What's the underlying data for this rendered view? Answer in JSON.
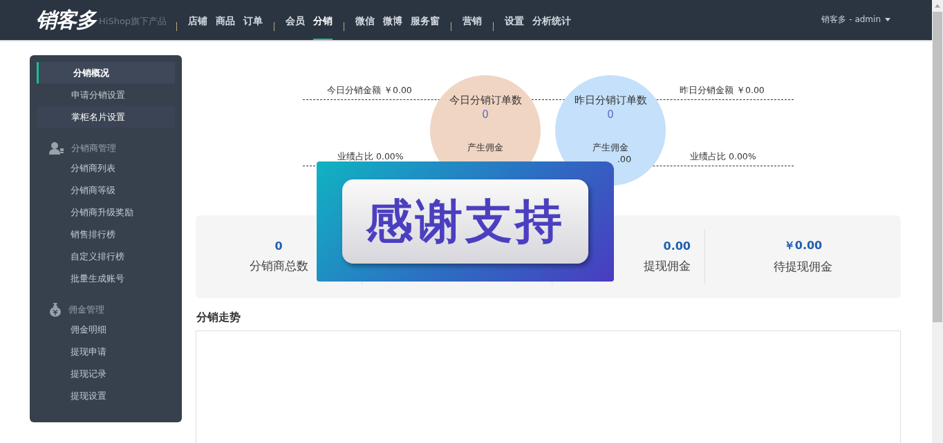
{
  "header": {
    "logo": "销客多",
    "tagline": "HiShop旗下产品",
    "nav": [
      {
        "kind": "sep"
      },
      {
        "kind": "link",
        "label": "店铺",
        "selected": false
      },
      {
        "kind": "link",
        "label": "商品",
        "selected": false
      },
      {
        "kind": "link",
        "label": "订单",
        "selected": false
      },
      {
        "kind": "sep"
      },
      {
        "kind": "link",
        "label": "会员",
        "selected": false
      },
      {
        "kind": "link",
        "label": "分销",
        "selected": true
      },
      {
        "kind": "sep"
      },
      {
        "kind": "link",
        "label": "微信",
        "selected": false
      },
      {
        "kind": "link",
        "label": "微博",
        "selected": false
      },
      {
        "kind": "link",
        "label": "服务窗",
        "selected": false
      },
      {
        "kind": "sep"
      },
      {
        "kind": "link",
        "label": "营销",
        "selected": false
      },
      {
        "kind": "sep"
      },
      {
        "kind": "link",
        "label": "设置",
        "selected": false
      },
      {
        "kind": "link",
        "label": "分析统计",
        "selected": false
      }
    ],
    "user": "销客多 - admin"
  },
  "sidebar": {
    "top_items": [
      {
        "label": "分销概况",
        "selected": true
      },
      {
        "label": "申请分销设置",
        "selected": false
      },
      {
        "label": "掌柜名片设置",
        "selected": false
      }
    ],
    "groups": [
      {
        "title": "分销商管理",
        "items": [
          {
            "label": "分销商列表",
            "selected": false
          },
          {
            "label": "分销商等级",
            "selected": false
          },
          {
            "label": "分销商升级奖励",
            "selected": false
          },
          {
            "label": "销售排行榜",
            "selected": false
          },
          {
            "label": "自定义排行榜",
            "selected": false
          },
          {
            "label": "批量生成账号",
            "selected": false
          }
        ]
      },
      {
        "title": "佣金管理",
        "items": [
          {
            "label": "佣金明细",
            "selected": false
          },
          {
            "label": "提现申请",
            "selected": false
          },
          {
            "label": "提现记录",
            "selected": false
          },
          {
            "label": "提现设置",
            "selected": false
          }
        ]
      }
    ]
  },
  "overview": {
    "today_amount": "今日分销金额 ￥0.00",
    "today_share": "业绩占比 0.00%",
    "yesterday_amount": "昨日分销金额 ￥0.00",
    "yesterday_share": "业绩占比 0.00%",
    "circles": [
      {
        "title": "今日分销订单数",
        "value": "0",
        "commission_label": "产生佣金"
      },
      {
        "title": "昨日分销订单数",
        "value": "0",
        "commission_label": "产生佣金",
        "commission": ".00"
      }
    ]
  },
  "stats": [
    {
      "kind": "shown",
      "value": "0",
      "label": "分销商总数"
    },
    {
      "kind": "covered"
    },
    {
      "kind": "shown",
      "value": "0.00",
      "label": "提现佣金"
    },
    {
      "kind": "shown",
      "value": "￥0.00",
      "label": "待提现佣金"
    }
  ],
  "overlay": {
    "text": "感谢支持"
  },
  "trend": {
    "title": "分销走势"
  }
}
